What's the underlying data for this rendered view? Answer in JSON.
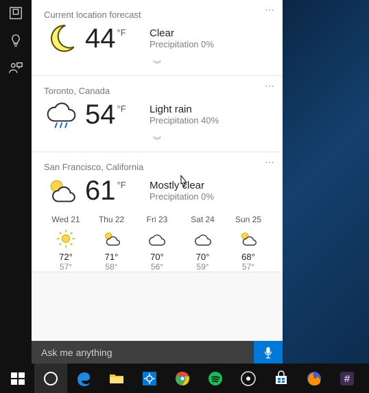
{
  "left_rail": {
    "items": [
      "home-icon",
      "bulb-icon",
      "person-chat-icon"
    ]
  },
  "cards": [
    {
      "title": "Current location forecast",
      "icon": "moon",
      "temp": "44",
      "unit": "°F",
      "condition": "Clear",
      "precip": "Precipitation 0%"
    },
    {
      "title": "Toronto, Canada",
      "icon": "rain",
      "temp": "54",
      "unit": "°F",
      "condition": "Light rain",
      "precip": "Precipitation 40%"
    },
    {
      "title": "San Francisco, California",
      "icon": "partly",
      "temp": "61",
      "unit": "°F",
      "condition": "Mostly clear",
      "precip": "Precipitation 0%",
      "forecast": [
        {
          "label": "Wed 21",
          "icon": "sunny",
          "hi": "72°",
          "lo": "57°"
        },
        {
          "label": "Thu 22",
          "icon": "partly",
          "hi": "71°",
          "lo": "58°"
        },
        {
          "label": "Fri 23",
          "icon": "cloudy",
          "hi": "70°",
          "lo": "56°"
        },
        {
          "label": "Sat 24",
          "icon": "cloudy",
          "hi": "70°",
          "lo": "59°"
        },
        {
          "label": "Sun 25",
          "icon": "partly",
          "hi": "68°",
          "lo": "57°"
        }
      ]
    }
  ],
  "search": {
    "placeholder": "Ask me anything"
  },
  "taskbar": {
    "items": [
      "start",
      "cortana",
      "edge",
      "file-explorer",
      "settings",
      "chrome",
      "spotify",
      "media",
      "store",
      "firefox",
      "slack"
    ]
  },
  "colors": {
    "accent": "#0078d7"
  }
}
